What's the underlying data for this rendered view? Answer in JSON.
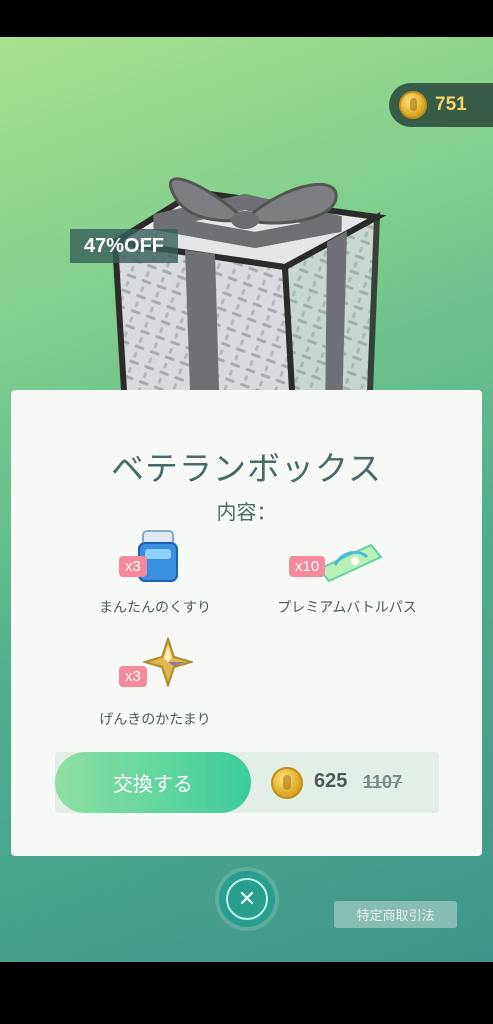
{
  "coins": {
    "balance": "751"
  },
  "offer": {
    "discount_label": "47%OFF",
    "title": "ベテランボックス",
    "contents_label": "内容："
  },
  "items": [
    {
      "name": "まんたんのくすり",
      "qty": "x3",
      "icon": "max-potion-icon"
    },
    {
      "name": "プレミアムバトルパス",
      "qty": "x10",
      "icon": "premium-battle-pass-icon"
    },
    {
      "name": "げんきのかたまり",
      "qty": "x3",
      "icon": "max-revive-icon"
    }
  ],
  "purchase": {
    "button_label": "交換する",
    "price": "625",
    "original_price": "1107"
  },
  "footer": {
    "close_icon": "close-icon",
    "legal_label": "特定商取引法"
  }
}
